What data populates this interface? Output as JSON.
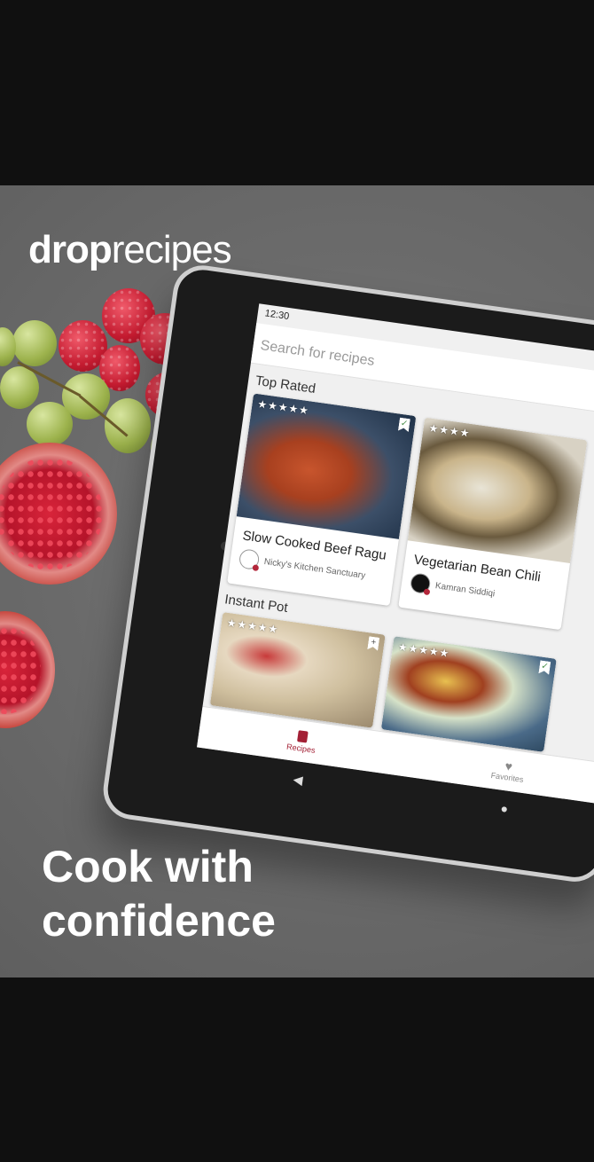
{
  "brand": {
    "logo_bold": "drop",
    "logo_light": "recipes"
  },
  "tagline": {
    "line1": "Cook with",
    "line2": "confidence"
  },
  "device": {
    "status_time": "12:30",
    "search": {
      "placeholder": "Search for recipes"
    },
    "sections": [
      {
        "title": "Top Rated",
        "cards": [
          {
            "title": "Slow Cooked Beef Ragu",
            "author": "Nicky's Kitchen Sanctuary",
            "stars": "★★★★★",
            "bookmarked": "✓",
            "bookmark_icon": "bookmark-check-icon"
          },
          {
            "title": "Vegetarian Bean Chili",
            "author": "Kamran Siddiqi",
            "stars": "★★★★"
          }
        ]
      },
      {
        "title": "Instant Pot",
        "cards": [
          {
            "stars": "★★★★★",
            "bookmark": "+",
            "bookmark_icon": "bookmark-add-icon"
          },
          {
            "stars": "★★★★★",
            "bookmarked": "✓"
          }
        ]
      }
    ],
    "bottom_nav": {
      "recipes": {
        "label": "Recipes",
        "icon": "book-icon",
        "color": "#a32035"
      },
      "favorites": {
        "label": "Favorites",
        "icon": "heart-icon",
        "glyph": "♥"
      }
    },
    "system_nav": {
      "back": "◀",
      "home": "●"
    }
  },
  "colors": {
    "accent": "#a32035",
    "background": "#6b6b6b",
    "frame": "#101010"
  }
}
